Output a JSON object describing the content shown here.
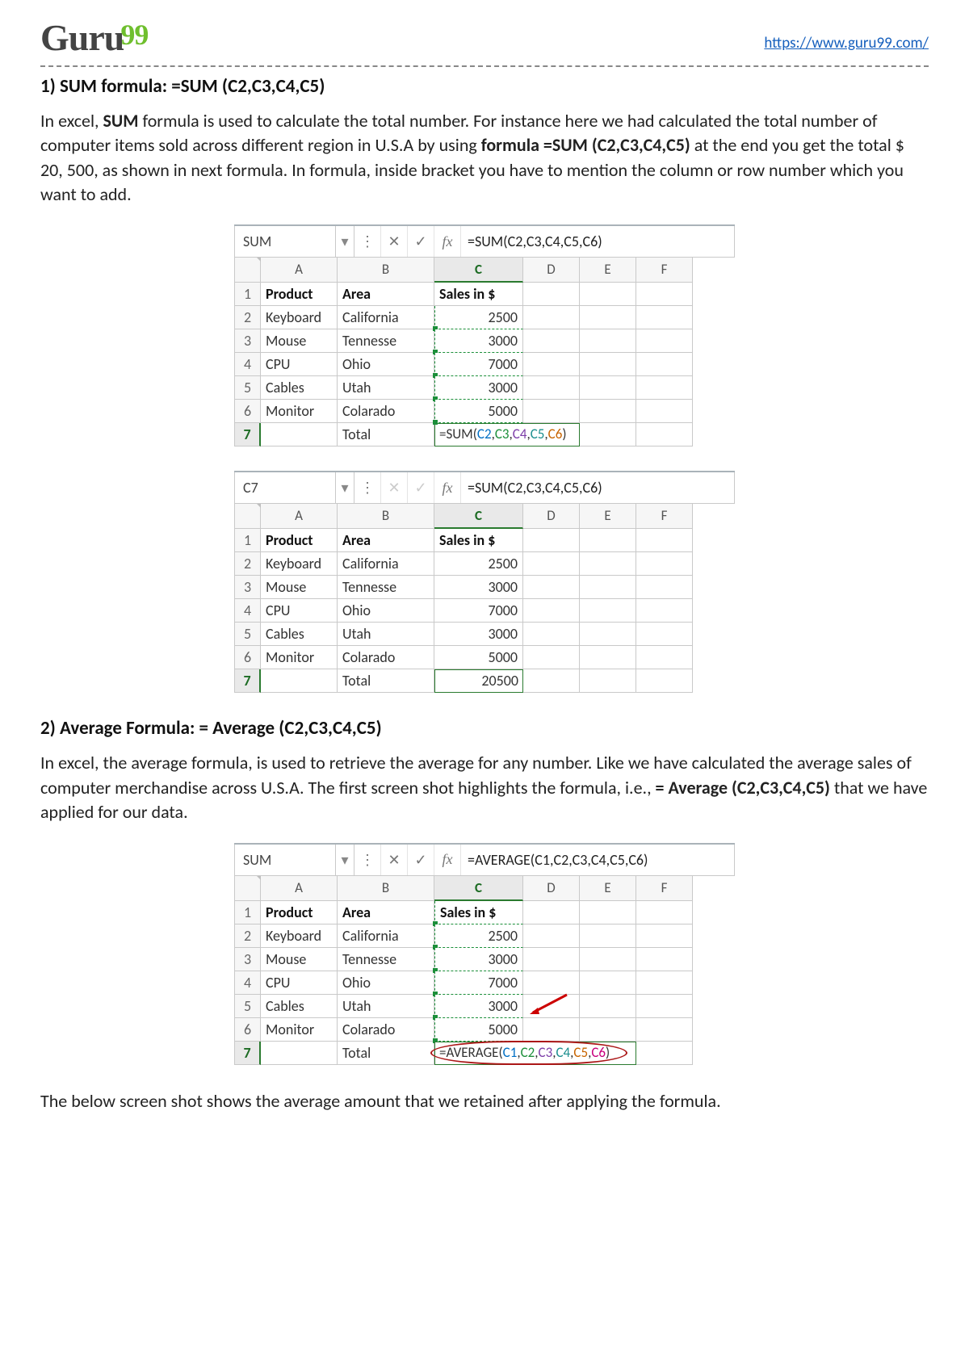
{
  "header": {
    "logo_main": "Guru",
    "logo_sup": "99",
    "url": "https://www.guru99.com/"
  },
  "section1": {
    "title": "1) SUM formula: =SUM (C2,C3,C4,C5)",
    "para_a": "In excel, ",
    "para_b": "SUM",
    "para_c": " formula is used to calculate the total number. For instance here we had calculated the total number of computer items sold across different region in U.S.A by using ",
    "para_d": "formula =SUM (C2,C3,C4,C5)",
    "para_e": " at the end you get the total $ 20, 500, as shown in next formula. In formula, inside bracket you have to mention the column or row number which you want to add."
  },
  "grid_common": {
    "cols": [
      "A",
      "B",
      "C",
      "D",
      "E",
      "F"
    ],
    "h1": "Product",
    "h2": "Area",
    "h3": "Sales in $",
    "total_label": "Total"
  },
  "grid1": {
    "namebox": "SUM",
    "formula": "=SUM(C2,C3,C4,C5,C6)",
    "rows": [
      {
        "n": "1",
        "a": "Product",
        "b": "Area",
        "c": "Sales in $",
        "head": true
      },
      {
        "n": "2",
        "a": "Keyboard",
        "b": "California",
        "c": "2500"
      },
      {
        "n": "3",
        "a": "Mouse",
        "b": "Tennesse",
        "c": "3000"
      },
      {
        "n": "4",
        "a": "CPU",
        "b": "Ohio",
        "c": "7000"
      },
      {
        "n": "5",
        "a": "Cables",
        "b": "Utah",
        "c": "3000"
      },
      {
        "n": "6",
        "a": "Monitor",
        "b": "Colarado",
        "c": "5000"
      }
    ],
    "total_formula_plain": "=SUM(C2,C3,C4,C5,C6)"
  },
  "grid2": {
    "namebox": "C7",
    "formula": "=SUM(C2,C3,C4,C5,C6)",
    "rows": [
      {
        "n": "1",
        "a": "Product",
        "b": "Area",
        "c": "Sales in $",
        "head": true
      },
      {
        "n": "2",
        "a": "Keyboard",
        "b": "California",
        "c": "2500"
      },
      {
        "n": "3",
        "a": "Mouse",
        "b": "Tennesse",
        "c": "3000"
      },
      {
        "n": "4",
        "a": "CPU",
        "b": "Ohio",
        "c": "7000"
      },
      {
        "n": "5",
        "a": "Cables",
        "b": "Utah",
        "c": "3000"
      },
      {
        "n": "6",
        "a": "Monitor",
        "b": "Colarado",
        "c": "5000"
      }
    ],
    "total_value": "20500"
  },
  "section2": {
    "title": "2) Average Formula: = Average (C2,C3,C4,C5)",
    "para_a": "In excel, the average formula, is used to retrieve the average for any number. Like we have calculated the average sales of computer merchandise across U.S.A. The first screen shot highlights the formula, i.e., ",
    "para_b": "= Average (C2,C3,C4,C5)",
    "para_c": " that we have applied for our data."
  },
  "grid3": {
    "namebox": "SUM",
    "formula": "=AVERAGE(C1,C2,C3,C4,C5,C6)",
    "rows": [
      {
        "n": "1",
        "a": "Product",
        "b": "Area",
        "c": "Sales in $",
        "head": true
      },
      {
        "n": "2",
        "a": "Keyboard",
        "b": "California",
        "c": "2500"
      },
      {
        "n": "3",
        "a": "Mouse",
        "b": "Tennesse",
        "c": "3000"
      },
      {
        "n": "4",
        "a": "CPU",
        "b": "Ohio",
        "c": "7000"
      },
      {
        "n": "5",
        "a": "Cables",
        "b": "Utah",
        "c": "3000"
      },
      {
        "n": "6",
        "a": "Monitor",
        "b": "Colarado",
        "c": "5000"
      }
    ],
    "total_formula_plain": "=AVERAGE(C1,C2,C3,C4,C5,C6)"
  },
  "footer_para": "The below screen shot shows the average amount that we retained after applying the formula.",
  "icons": {
    "dropdown": "▾",
    "more": "⋮",
    "cancel": "✕",
    "enter": "✓",
    "fx": "fx"
  }
}
